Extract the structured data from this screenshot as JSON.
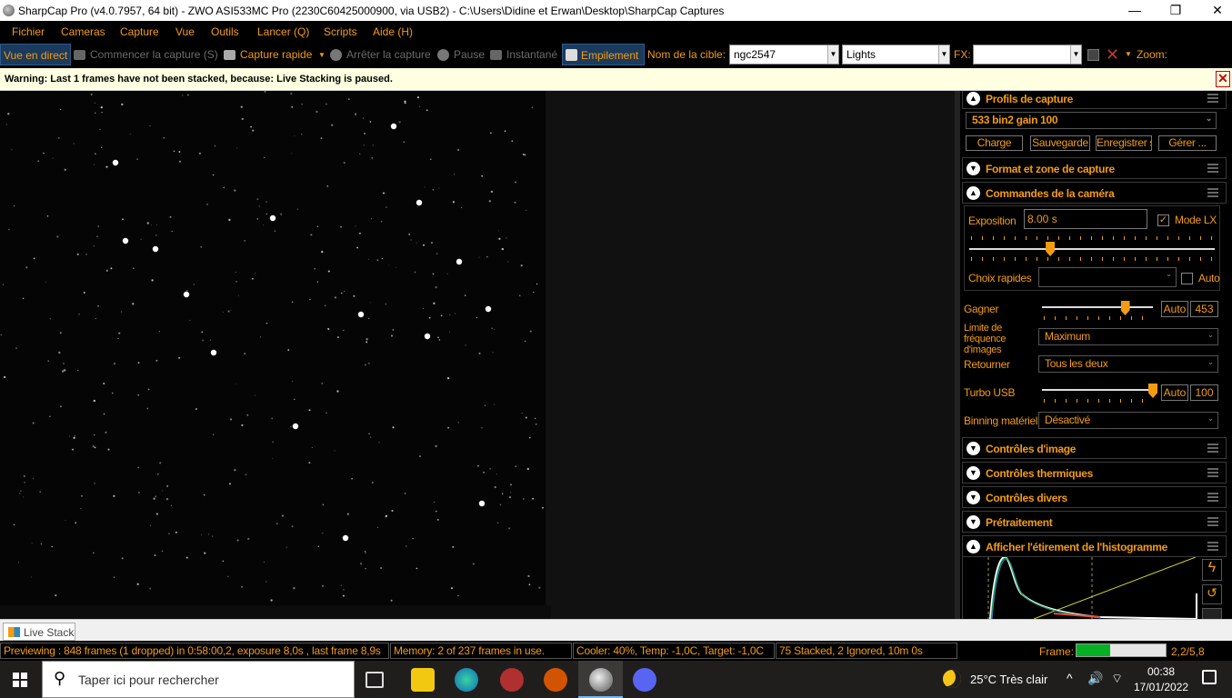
{
  "window": {
    "title": "SharpCap Pro (v4.0.7957, 64 bit) - ZWO ASI533MC Pro (2230C60425000900, via USB2) - C:\\Users\\Didine et Erwan\\Desktop\\SharpCap Captures",
    "minimize": "—",
    "maximize": "❐",
    "close": "✕"
  },
  "menu": [
    "Fichier",
    "Cameras",
    "Capture",
    "Vue",
    "Outils",
    "Lancer (Q)",
    "Scripts",
    "Aide (H)"
  ],
  "toolbar": {
    "live_view": "Vue en direct",
    "start_capture": "Commencer la capture (S)",
    "quick_capture": "Capture rapide",
    "stop_capture": "Arrêter la capture",
    "pause": "Pause",
    "snapshot": "Instantané",
    "stacking": "Empilement",
    "target_label": "Nom de la cible:",
    "target_value": "ngc2547",
    "frame_type": "Lights",
    "fx_label": "FX:",
    "fx_value": "",
    "zoom_label": "Zoom:"
  },
  "warning": {
    "text": "Warning: Last 1 frames have not been stacked, because: Live Stacking is paused.",
    "close": "✕"
  },
  "panel": {
    "profiles": {
      "title": "Profils de capture",
      "selected": "533 bin2 gain 100",
      "buttons": [
        "Charge",
        "Sauvegarde",
        "Enregistrer s",
        "Gérer ..."
      ]
    },
    "format_title": "Format et zone de capture",
    "camera_controls": {
      "title": "Commandes de la caméra",
      "exposure_label": "Exposition",
      "exposure_value": "8.00 s",
      "lx_mode_label": "Mode LX",
      "lx_checked": "✓",
      "quick_picks_label": "Choix rapides",
      "quick_picks_value": "",
      "auto_label": "Auto",
      "gain_label": "Gagner",
      "gain_auto": "Auto",
      "gain_value": "453",
      "frame_rate_label": "Limite de fréquence d'images",
      "frame_rate_value": "Maximum",
      "flip_label": "Retourner",
      "flip_value": "Tous les deux",
      "usb_label": "Turbo USB",
      "usb_auto": "Auto",
      "usb_value": "100",
      "binning_label": "Binning matériel",
      "binning_value": "Désactivé",
      "exposure_slider": 0.33,
      "gain_slider": 0.75,
      "usb_slider": 1.0
    },
    "image_controls_title": "Contrôles d'image",
    "thermal_controls_title": "Contrôles thermiques",
    "misc_controls_title": "Contrôles divers",
    "preprocessing_title": "Prétraitement",
    "histogram_title": "Afficher l'étirement de l'histogramme"
  },
  "tab": {
    "label": "Live Stack"
  },
  "status": {
    "preview": "Previewing : 848 frames (1 dropped) in 0:58:00,2, exposure 8,0s , last frame 8,9s",
    "memory": "Memory: 2 of 237 frames in use.",
    "cooler": "Cooler: 40%, Temp: -1,0C, Target: -1,0C",
    "stacked": "75 Stacked, 2 Ignored, 10m 0s",
    "frame_label": "Frame:",
    "frame_value": "2,2/5,8",
    "frame_progress": 0.38
  },
  "taskbar": {
    "search_placeholder": "Taper ici pour rechercher",
    "weather": "25°C  Très clair",
    "time": "00:38",
    "date": "17/01/2022"
  }
}
